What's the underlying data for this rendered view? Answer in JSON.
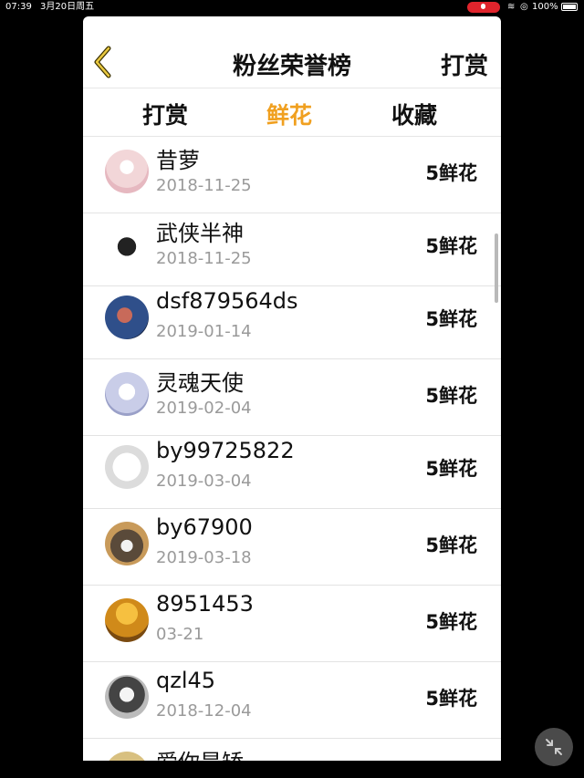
{
  "statusbar": {
    "time": "07:39",
    "date": "3月20日周五",
    "battery_percent": "100%",
    "recording": true
  },
  "navbar": {
    "back_icon": "chevron-left-icon",
    "title": "粉丝荣誉榜",
    "right_action": "打赏"
  },
  "tabs": [
    {
      "label": "打赏",
      "active": false
    },
    {
      "label": "鲜花",
      "active": true
    },
    {
      "label": "收藏",
      "active": false
    }
  ],
  "colors": {
    "accent": "#f0a020",
    "text": "#111111",
    "subtext": "#9a9a9a",
    "back_icon_fill": "#e8c840"
  },
  "list": [
    {
      "name": "昔萝",
      "date": "2018-11-25",
      "amount": "5鲜花",
      "avatar_color": "#f2d6d8"
    },
    {
      "name": "武侠半神",
      "date": "2018-11-25",
      "amount": "5鲜花",
      "avatar_color": "#3a3a3a"
    },
    {
      "name": "dsf879564ds",
      "date": "2019-01-14",
      "amount": "5鲜花",
      "avatar_color": "#2f4f8a"
    },
    {
      "name": "灵魂天使",
      "date": "2019-02-04",
      "amount": "5鲜花",
      "avatar_color": "#c9cde8"
    },
    {
      "name": "by99725822",
      "date": "2019-03-04",
      "amount": "5鲜花",
      "avatar_color": "#e8e8e8"
    },
    {
      "name": "by67900",
      "date": "2019-03-18",
      "amount": "5鲜花",
      "avatar_color": "#7a5a2a"
    },
    {
      "name": "8951453",
      "date": "03-21",
      "amount": "5鲜花",
      "avatar_color": "#d08a1a"
    },
    {
      "name": "qzl45",
      "date": "2018-12-04",
      "amount": "5鲜花",
      "avatar_color": "#9a9a9a"
    },
    {
      "name": "爱你是矫",
      "date": "",
      "amount": "",
      "avatar_color": "#d8c080"
    }
  ]
}
